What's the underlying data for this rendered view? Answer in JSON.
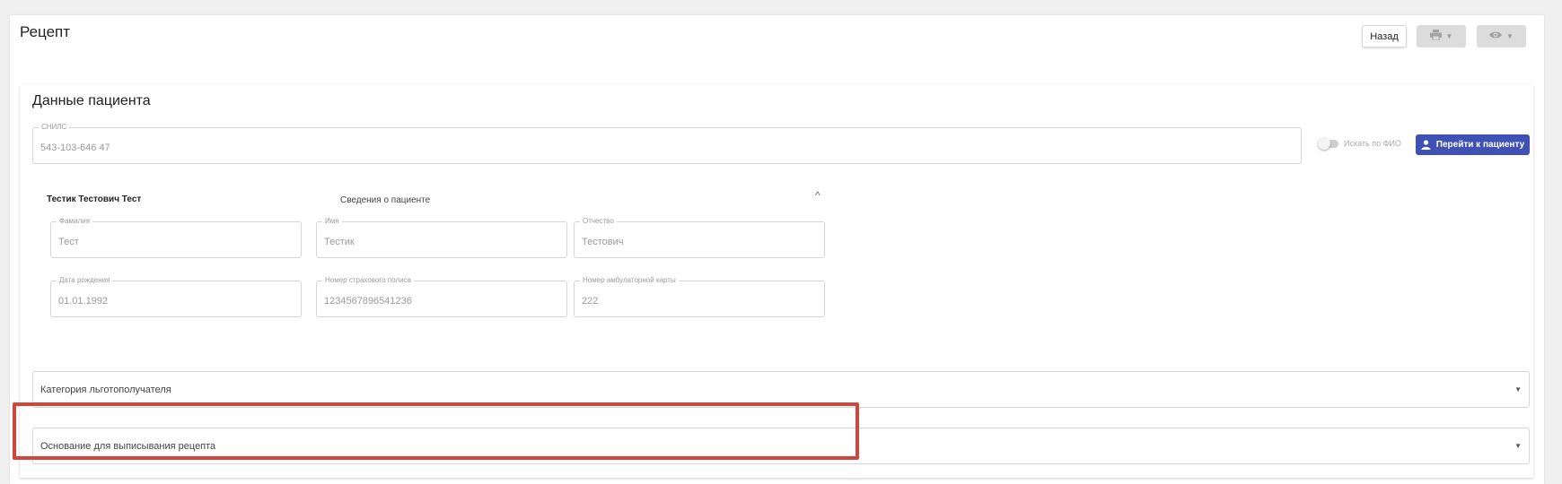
{
  "page": {
    "title": "Рецепт",
    "back_label": "Назад",
    "print_icon": "printer-icon",
    "view_icon": "eye-icon"
  },
  "patient_section": {
    "title": "Данные пациента",
    "snils": {
      "label": "СНИЛС",
      "value": "543-103-646 47"
    },
    "search_by_fio": {
      "label": "Искать по ФИО",
      "checked": false
    },
    "goto_patient_label": "Перейти к пациенту",
    "patient_name": "Тестик Тестович Тест",
    "patient_info_label": "Сведения о пациенте",
    "fields": {
      "last_name": {
        "label": "Фамилия",
        "value": "Тест"
      },
      "first_name": {
        "label": "Имя",
        "value": "Тестик"
      },
      "middle_name": {
        "label": "Отчество",
        "value": "Тестович"
      },
      "birth_date": {
        "label": "Дата рождения",
        "value": "01.01.1992"
      },
      "insurance_number": {
        "label": "Номер страхового полиса",
        "value": "1234567896541236"
      },
      "outpatient_card": {
        "label": "Номер амбулаторной карты",
        "value": "222"
      }
    },
    "benefit_category_placeholder": "Категория льготополучателя",
    "prescription_basis_placeholder": "Основание для выписывания рецепта"
  },
  "colors": {
    "primary": "#3f51b5",
    "highlight": "#d2453c"
  }
}
